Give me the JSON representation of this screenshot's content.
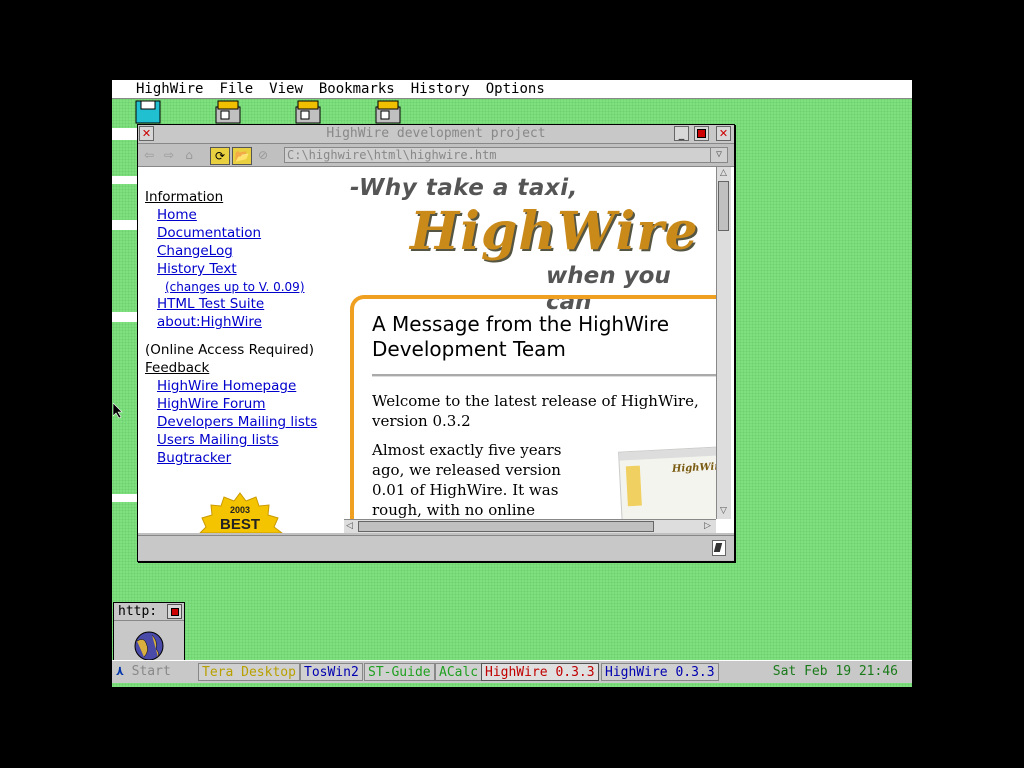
{
  "menubar": {
    "items": [
      "HighWire",
      "File",
      "View",
      "Bookmarks",
      "History",
      "Options"
    ]
  },
  "window": {
    "title": "HighWire development project",
    "url": "C:\\highwire\\html\\highwire.htm",
    "close_icon": "close-icon",
    "iconify_icon": "iconify-icon",
    "fulled_icon": "fulled-icon"
  },
  "leftframe": {
    "information": "Information",
    "home": "Home",
    "documentation": "Documentation",
    "changelog": "ChangeLog",
    "history_text": "History Text",
    "history_sub": "(changes up to V. 0.09)",
    "html_test_suite": "HTML Test Suite",
    "about": "about:HighWire",
    "online_required": "(Online Access Required)",
    "feedback": "Feedback",
    "homepage": "HighWire Homepage",
    "forum": "HighWire Forum",
    "dev_lists": "Developers Mailing lists",
    "user_lists": "Users Mailing lists",
    "bugtracker": "Bugtracker",
    "award_year": "2003",
    "award_text": "BEST"
  },
  "rightframe": {
    "banner_line1": "-Why take a taxi,",
    "banner_logo": "HighWire",
    "banner_line3": "when you can",
    "message_title": "A Message from the HighWire Development Team",
    "para1": "Welcome to the latest release of HighWire, version 0.3.2",
    "para2": "Almost exactly five years ago, we released version 0.01 of HighWire. It was rough, with no online",
    "thumb_text": "HighWire"
  },
  "httpwin": {
    "title": "http:"
  },
  "taskbar": {
    "start": "Start",
    "tasks": [
      {
        "label": "Tera Desktop",
        "color": "#b8a000"
      },
      {
        "label": "TosWin2",
        "color": "#0000b0"
      },
      {
        "label": "ST-Guide",
        "color": "#20a020"
      },
      {
        "label": "ACalc",
        "color": "#20a020"
      },
      {
        "label": "HighWire 0.3.3",
        "color": "#c00000"
      },
      {
        "label": "HighWire 0.3.3",
        "color": "#0000b0"
      }
    ],
    "clock": "Sat Feb 19 21:46"
  }
}
